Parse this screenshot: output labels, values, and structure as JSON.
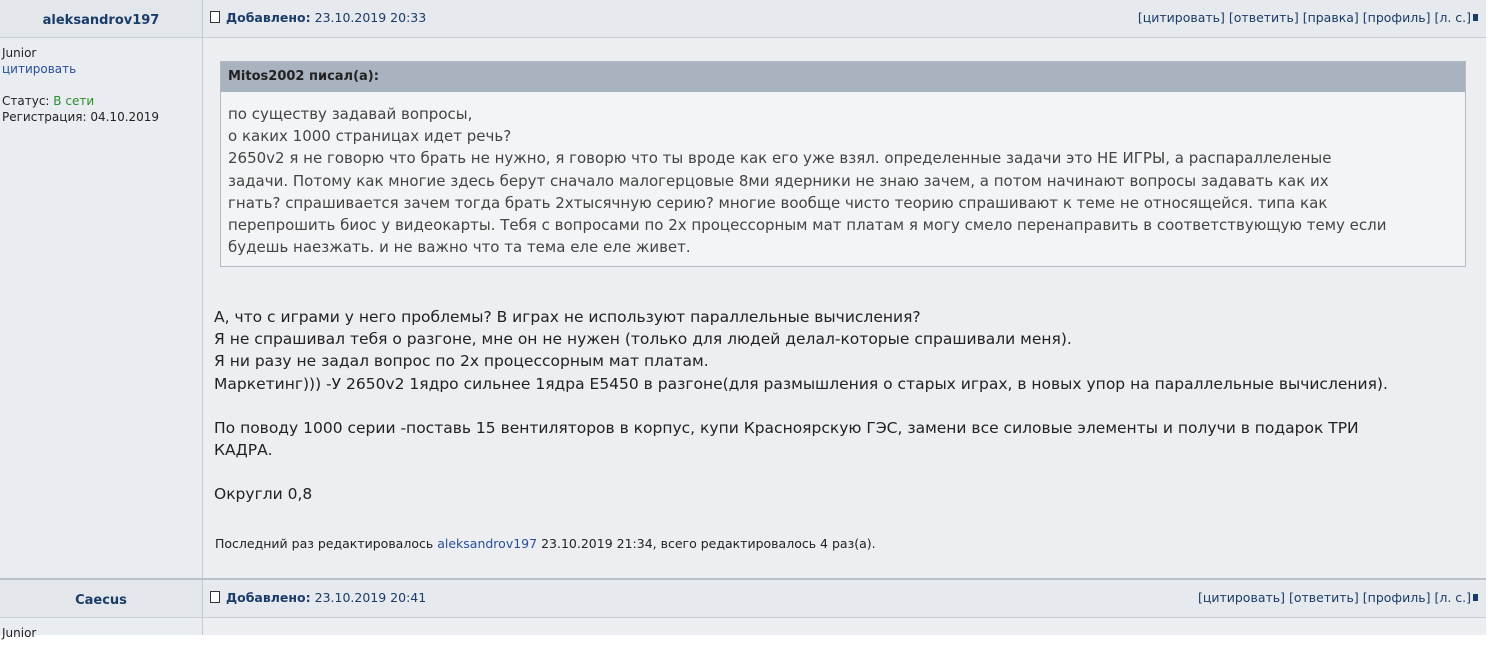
{
  "posts": [
    {
      "author": "aleksandrov197",
      "rank": "Junior",
      "quote_link": "цитировать",
      "status_label": "Статус:",
      "status_value": "В сети",
      "registration_label": "Регистрация:",
      "registration_value": "04.10.2019",
      "added_label": "Добавлено:",
      "added_date": "23.10.2019 20:33",
      "actions": [
        "[цитировать]",
        "[ответить]",
        "[правка]",
        "[профиль]",
        "[л. с.]"
      ],
      "quote": {
        "title": "Mitos2002 писал(а):",
        "lines": [
          "по существу задавай вопросы,",
          "о каких 1000 страницах идет речь?",
          "2650v2 я не говорю что брать не нужно, я говорю что ты вроде как его уже взял. определенные задачи это НЕ ИГРЫ, а распараллеленые",
          "задачи. Потому как многие здесь берут сначало малогерцовые 8ми ядерники не знаю зачем, а потом начинают вопросы задавать как их",
          "гнать? спрашивается зачем тогда брать 2хтысячную серию? многие вообще чисто теорию спрашивают к теме не относящейся. типа как",
          "перепрошить биос у видеокарты. Тебя с вопросами по 2х процессорным мат платам я могу смело перенаправить в соответствующую тему если",
          "будешь наезжать. и не важно что та тема еле еле живет."
        ]
      },
      "message": {
        "para1": [
          "А, что с играми у него проблемы? В играх не используют параллельные вычисления?",
          "Я не спрашивал тебя о разгоне, мне он не нужен (только для людей делал-которые спрашивали меня).",
          "Я ни разу не задал вопрос по 2х процессорным мат платам.",
          "Маркетинг))) -У 2650v2 1ядро сильнее 1ядра E5450 в разгоне(для размышления о старых играх, в новых упор на параллельные вычисления)."
        ],
        "para2": [
          "По поводу 1000 серии -поставь 15 вентиляторов в корпус, купи Красноярскую ГЭС, замени все силовые элементы и получи в подарок ТРИ",
          "КАДРА."
        ],
        "para3": "Округли 0,8"
      },
      "edited_prefix": "Последний раз редактировалось",
      "edited_user": "aleksandrov197",
      "edited_suffix": "23.10.2019 21:34, всего редактировалось 4 раз(а)."
    },
    {
      "author": "Caecus",
      "rank": "Junior",
      "added_label": "Добавлено:",
      "added_date": "23.10.2019 20:41",
      "actions": [
        "[цитировать]",
        "[ответить]",
        "[профиль]",
        "[л. с.]"
      ]
    }
  ]
}
